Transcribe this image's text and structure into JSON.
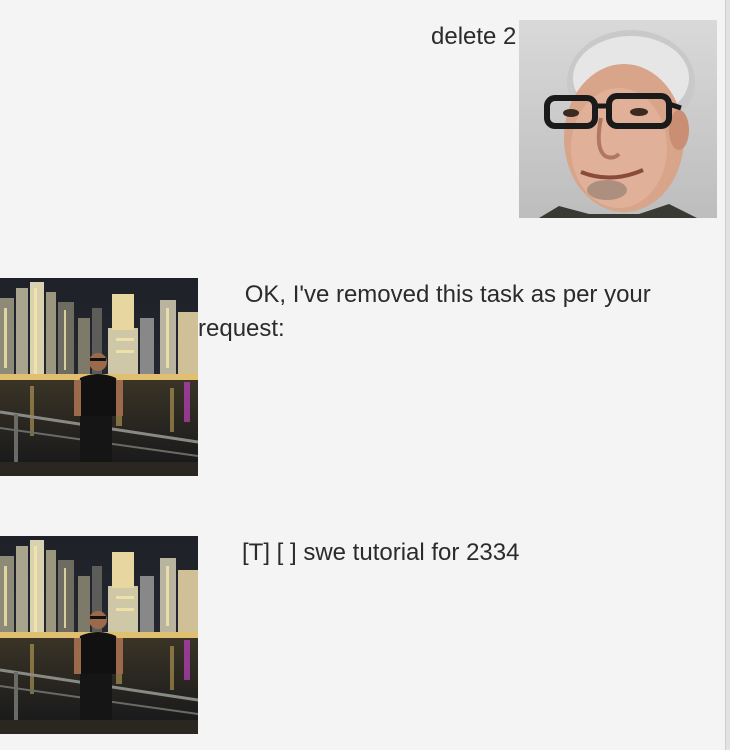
{
  "dialog": {
    "user_message": {
      "text": "delete 2",
      "avatar_icon": "user-avatar-icon"
    },
    "bot_replies": [
      {
        "text": "       OK, I've removed this task as per your\nrequest:",
        "avatar_icon": "bot-avatar-icon"
      },
      {
        "text": "[T] [ ] swe tutorial for 2334",
        "avatar_icon": "bot-avatar-icon"
      }
    ]
  },
  "colors": {
    "background": "#f4f4f4",
    "text": "#2b2b2b"
  }
}
